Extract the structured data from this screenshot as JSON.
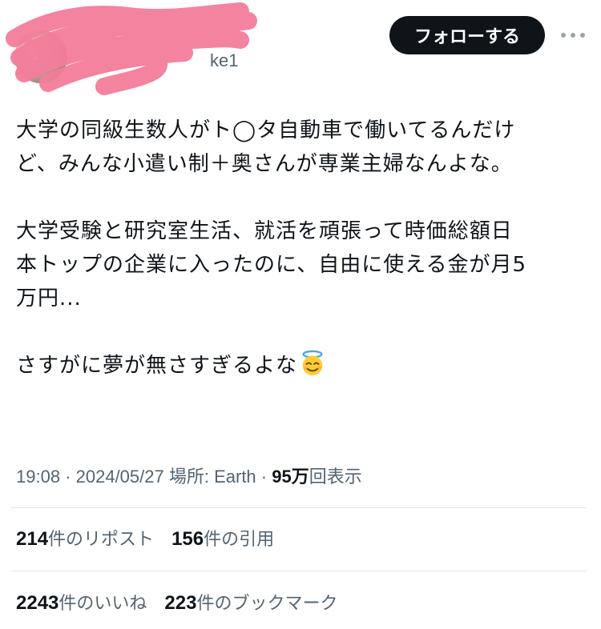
{
  "header": {
    "handle_visible": "ke1",
    "follow_label": "フォローする",
    "more_icon": "more-horizontal-icon"
  },
  "tweet": {
    "paragraphs": [
      [
        "大学の同級生数人がト◯タ自動車で働いてるんだけ",
        "ど、みんな小遣い制＋奥さんが専業主婦なんよな。"
      ],
      [
        "大学受験と研究室生活、就活を頑張って時価総額日",
        "本トップの企業に入ったのに、自由に使える金が月5",
        "万円..."
      ],
      [
        "さすがに夢が無さすぎるよな"
      ]
    ],
    "emoji": "smiling-face-with-halo"
  },
  "meta": {
    "time": "19:08",
    "sep": " · ",
    "date": "2024/05/27",
    "location": "場所: Earth",
    "views_num": "95万",
    "views_label": "回表示"
  },
  "stats": {
    "reposts_num": "214",
    "reposts_label": "件のリポスト",
    "quotes_num": "156",
    "quotes_label": "件の引用",
    "likes_num": "2243",
    "likes_label": "件のいいね",
    "bookmarks_num": "223",
    "bookmarks_label": "件のブックマーク"
  },
  "colors": {
    "text": "#0f1419",
    "secondary": "#536471",
    "redaction": "#f47d9b",
    "button_bg": "#0f1419"
  }
}
